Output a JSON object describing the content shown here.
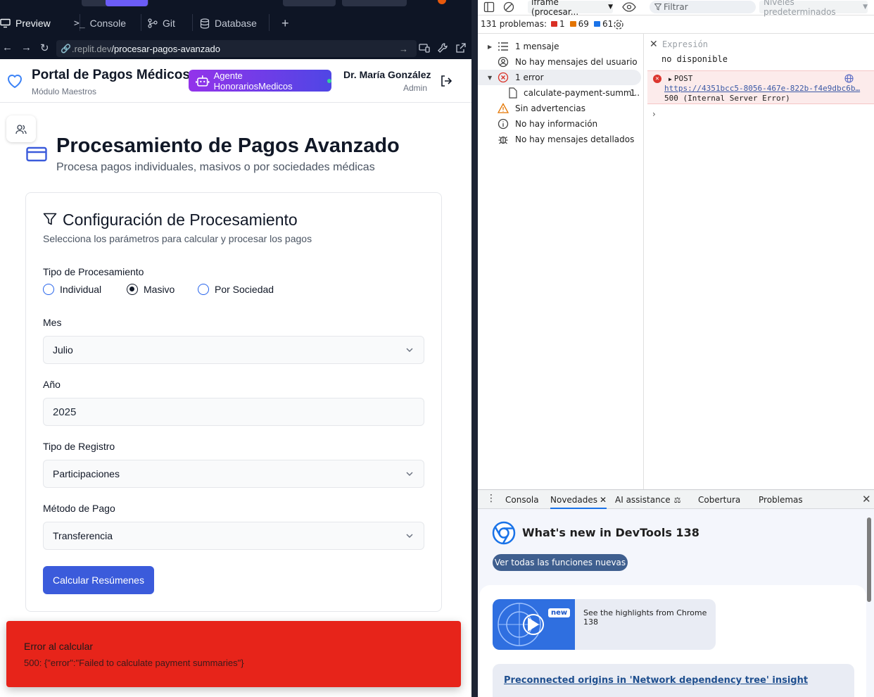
{
  "replit": {
    "tabs": [
      {
        "label": "Preview",
        "active": true
      },
      {
        "label": "Console"
      },
      {
        "label": "Git"
      },
      {
        "label": "Database"
      }
    ],
    "add_tab": "+",
    "url_host": ".replit.dev",
    "url_path": "/procesar-pagos-avanzado"
  },
  "header": {
    "title": "Portal de Pagos Médicos",
    "subtitle": "Módulo Maestros",
    "agent_label": "Agente HonorariosMedicos",
    "user_name": "Dr. María González",
    "user_role": "Admin"
  },
  "page": {
    "title": "Procesamiento de Pagos Avanzado",
    "description": "Procesa pagos individuales, masivos o por sociedades médicas"
  },
  "config": {
    "title": "Configuración de Procesamiento",
    "description": "Selecciona los parámetros para calcular y procesar los pagos",
    "processing_type_label": "Tipo de Procesamiento",
    "options": [
      {
        "label": "Individual",
        "selected": false
      },
      {
        "label": "Masivo",
        "selected": true
      },
      {
        "label": "Por Sociedad",
        "selected": false
      }
    ],
    "month_label": "Mes",
    "month_value": "Julio",
    "year_label": "Año",
    "year_value": "2025",
    "record_type_label": "Tipo de Registro",
    "record_type_value": "Participaciones",
    "payment_method_label": "Método de Pago",
    "payment_method_value": "Transferencia",
    "calc_button": "Calcular Resúmenes"
  },
  "toast": {
    "title": "Error al calcular",
    "message": "500: {\"error\":\"Failed to calculate payment summaries\"}",
    "color": "#e7241a"
  },
  "devtools": {
    "context": "iframe (procesar...",
    "filter_placeholder": "Filtrar",
    "levels": "Niveles predeterminados",
    "issues_label": "131 problemas:",
    "issues_errors": "1",
    "issues_warnings": "69",
    "issues_info": "61",
    "sidebar": [
      {
        "label": "1 mensaje",
        "icon": "list-icon"
      },
      {
        "label": "No hay mensajes del usuario",
        "icon": "user-icon"
      },
      {
        "label": "1 error",
        "icon": "error-icon"
      },
      {
        "label": "calculate-payment-summ...",
        "count": "1",
        "icon": "file-icon"
      },
      {
        "label": "Sin advertencias",
        "icon": "warning-icon"
      },
      {
        "label": "No hay información",
        "icon": "info-icon"
      },
      {
        "label": "No hay mensajes detallados",
        "icon": "bug-icon"
      }
    ],
    "expression_placeholder": "Expresión",
    "expression_value": "no disponible",
    "error_method": "POST",
    "error_url": "https://4351bcc5-8056-467e-822b-f4e9dbc6b…",
    "error_status": "500 (Internal Server Error)",
    "drawer_tabs": [
      "Consola",
      "Novedades",
      "AI assistance",
      "Cobertura",
      "Problemas"
    ],
    "whats_new_title": "What's new in DevTools 138",
    "whats_new_button": "Ver todas las funciones nuevas",
    "highlight_badge": "new",
    "highlight_text": "See the highlights from Chrome 138",
    "link_text": "Preconnected origins in 'Network dependency tree' insight"
  }
}
